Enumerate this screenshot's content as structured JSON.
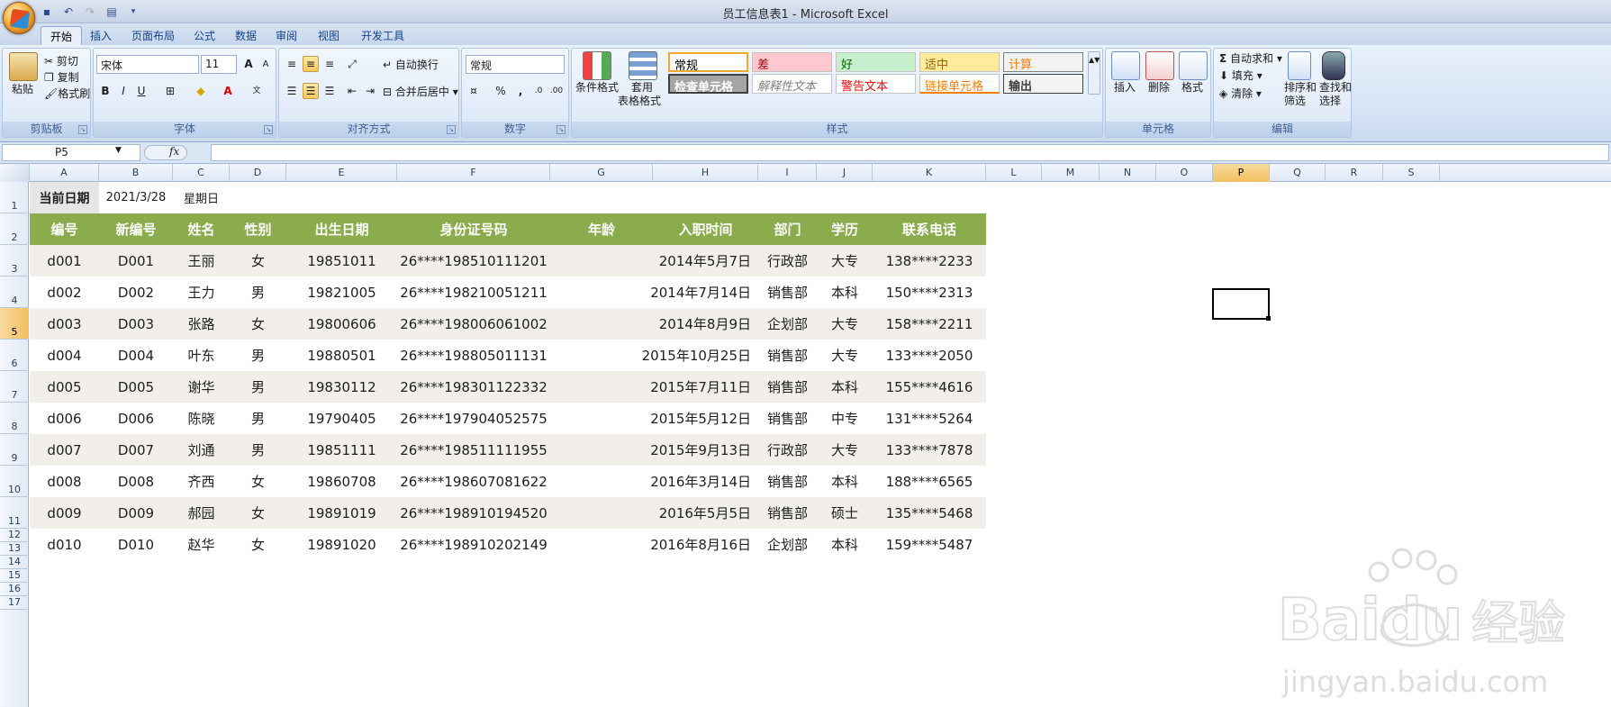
{
  "window": {
    "title": "员工信息表1 - Microsoft Excel"
  },
  "qat": {
    "icons": [
      "save-icon",
      "undo-icon",
      "redo-icon",
      "print-preview-icon",
      "customize-icon"
    ]
  },
  "tabs": [
    "开始",
    "插入",
    "页面布局",
    "公式",
    "数据",
    "审阅",
    "视图",
    "开发工具"
  ],
  "ribbon": {
    "clipboard": {
      "label": "剪贴板",
      "paste": "粘贴",
      "cut": "剪切",
      "copy": "复制",
      "format_painter": "格式刷"
    },
    "font": {
      "label": "字体",
      "font_name": "宋体",
      "font_size": "11",
      "bold": "B",
      "italic": "I",
      "underline": "U"
    },
    "alignment": {
      "label": "对齐方式",
      "wrap": "自动换行",
      "merge": "合并后居中"
    },
    "number": {
      "label": "数字",
      "format": "常规",
      "percent": "%",
      "comma": ","
    },
    "styles": {
      "label": "样式",
      "conditional": "条件格式",
      "table_format_1": "套用",
      "table_format_2": "表格格式",
      "items": [
        {
          "text": "常规"
        },
        {
          "text": "差"
        },
        {
          "text": "好"
        },
        {
          "text": "适中"
        },
        {
          "text": "计算"
        },
        {
          "text": "检查单元格"
        },
        {
          "text": "解释性文本"
        },
        {
          "text": "警告文本"
        },
        {
          "text": "链接单元格"
        },
        {
          "text": "输出"
        }
      ]
    },
    "cells": {
      "label": "单元格",
      "insert": "插入",
      "delete": "删除",
      "format": "格式"
    },
    "editing": {
      "label": "编辑",
      "autosum": "自动求和",
      "fill": "填充",
      "clear": "清除",
      "sort1": "排序和",
      "sort2": "筛选",
      "find1": "查找和",
      "find2": "选择"
    }
  },
  "formula_bar": {
    "name_box": "P5",
    "fx": "fx",
    "value": ""
  },
  "columns": [
    "A",
    "B",
    "C",
    "D",
    "E",
    "F",
    "G",
    "H",
    "I",
    "J",
    "K",
    "L",
    "M",
    "N",
    "O",
    "P",
    "Q",
    "R",
    "S"
  ],
  "selected_column": "P",
  "selected_row": "5",
  "rows": [
    "1",
    "2",
    "3",
    "4",
    "5",
    "6",
    "7",
    "8",
    "9",
    "10",
    "11",
    "12",
    "13",
    "14",
    "15",
    "16",
    "17"
  ],
  "sheet": {
    "date_label": "当前日期",
    "date_value": "2021/3/28",
    "weekday": "星期日",
    "header_color": "#8aac4d",
    "band_color": "#f2efeb",
    "headers": [
      "编号",
      "新编号",
      "姓名",
      "性别",
      "出生日期",
      "身份证号码",
      "年龄",
      "入职时间",
      "部门",
      "学历",
      "联系电话"
    ],
    "records": [
      [
        "d001",
        "D001",
        "王丽",
        "女",
        "19851011",
        "26****198510111201",
        "",
        "2014年5月7日",
        "行政部",
        "大专",
        "138****2233"
      ],
      [
        "d002",
        "D002",
        "王力",
        "男",
        "19821005",
        "26****198210051211",
        "",
        "2014年7月14日",
        "销售部",
        "本科",
        "150****2313"
      ],
      [
        "d003",
        "D003",
        "张路",
        "女",
        "19800606",
        "26****198006061002",
        "",
        "2014年8月9日",
        "企划部",
        "大专",
        "158****2211"
      ],
      [
        "d004",
        "D004",
        "叶东",
        "男",
        "19880501",
        "26****198805011131",
        "",
        "2015年10月25日",
        "销售部",
        "大专",
        "133****2050"
      ],
      [
        "d005",
        "D005",
        "谢华",
        "男",
        "19830112",
        "26****198301122332",
        "",
        "2015年7月11日",
        "销售部",
        "本科",
        "155****4616"
      ],
      [
        "d006",
        "D006",
        "陈晓",
        "男",
        "19790405",
        "26****197904052575",
        "",
        "2015年5月12日",
        "销售部",
        "中专",
        "131****5264"
      ],
      [
        "d007",
        "D007",
        "刘通",
        "男",
        "19851111",
        "26****198511111955",
        "",
        "2015年9月13日",
        "行政部",
        "大专",
        "133****7878"
      ],
      [
        "d008",
        "D008",
        "齐西",
        "女",
        "19860708",
        "26****198607081622",
        "",
        "2016年3月14日",
        "销售部",
        "本科",
        "188****6565"
      ],
      [
        "d009",
        "D009",
        "郝园",
        "女",
        "19891019",
        "26****198910194520",
        "",
        "2016年5月5日",
        "销售部",
        "硕士",
        "135****5468"
      ],
      [
        "d010",
        "D010",
        "赵华",
        "女",
        "19891020",
        "26****198910202149",
        "",
        "2016年8月16日",
        "企划部",
        "本科",
        "159****5487"
      ]
    ]
  },
  "watermark": {
    "brand": "Baidu",
    "cn": "经验",
    "url": "jingyan.baidu.com"
  }
}
